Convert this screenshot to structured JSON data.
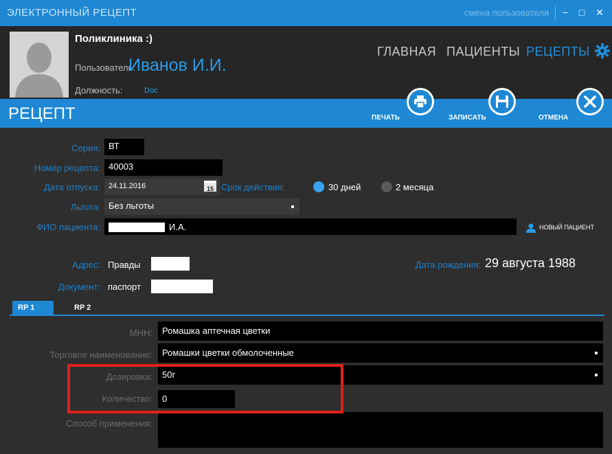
{
  "window": {
    "title": "ЭЛЕКТРОННЫЙ РЕЦЕПТ",
    "switch_user": "смена пользователя",
    "minimize": "−",
    "maximize": "□",
    "close": "✕"
  },
  "header": {
    "organization": "Поликлиника :)",
    "user_label": "Пользователь:",
    "user_name": "Иванов И.И.",
    "position_label": "Должность:",
    "position_value": "Doc",
    "nav": [
      "ГЛАВНАЯ",
      "ПАЦИЕНТЫ",
      "РЕЦЕПТЫ"
    ]
  },
  "rx_bar": {
    "title": "РЕЦЕПТ",
    "print_label": "ПЕЧАТЬ",
    "save_label": "ЗАПИСАТЬ",
    "cancel_label": "ОТМЕНА"
  },
  "form": {
    "series_label": "Серия:",
    "series_value": "ВТ",
    "number_label": "Номер рецепта:",
    "number_value": "40003",
    "date_label": "Дата отпуска:",
    "date_value": "24.11.2016",
    "calendar_day": "15",
    "validity_label": "Срок действия:",
    "validity_options": [
      "30 дней",
      "2 месяца"
    ],
    "validity_selected": "30 дней",
    "benefit_label": "Льгота:",
    "benefit_value": "Без льготы",
    "patient_label": "ФИО пациента:",
    "patient_value": "И.А.",
    "new_patient": "НОВЫЙ ПАЦИЕНТ",
    "address_label": "Адрес:",
    "address_value": "Правды",
    "birth_label": "Дата рождения:",
    "birth_value": "29 августа 1988",
    "document_label": "Документ:",
    "document_value": "паспорт"
  },
  "tabs": [
    "RP 1",
    "RP 2"
  ],
  "rp": {
    "inn_label": "МНН:",
    "inn_value": "Ромашка аптечная цветки",
    "trade_label": "Торговое наименование:",
    "trade_value": "Ромашки цветки обмолоченные",
    "dosage_label": "Дозировка:",
    "dosage_value": "50г",
    "quantity_label": "Количество:",
    "quantity_value": "0",
    "usage_label": "Способ применения:",
    "usage_value": ""
  },
  "colors": {
    "accent": "#1e88d4",
    "label_blue": "#1f7fc7",
    "highlight_red": "#e0201a"
  }
}
